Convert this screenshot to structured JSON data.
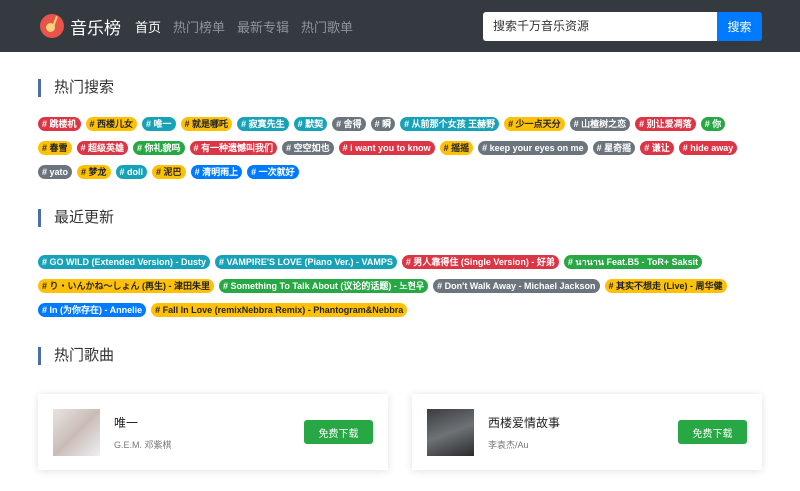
{
  "nav": {
    "brand": "音乐榜",
    "links": [
      "首页",
      "热门榜单",
      "最新专辑",
      "热门歌单"
    ],
    "search_placeholder": "搜索千万音乐资源",
    "search_button": "搜索"
  },
  "hot_search": {
    "title": "热门搜索",
    "tags": [
      {
        "text": "# 跳楼机",
        "color": "r"
      },
      {
        "text": "# 西楼儿女",
        "color": "y"
      },
      {
        "text": "# 唯一",
        "color": "t"
      },
      {
        "text": "# 就是哪吒",
        "color": "y"
      },
      {
        "text": "# 寂寞先生",
        "color": "t"
      },
      {
        "text": "# 默契",
        "color": "t"
      },
      {
        "text": "# 舍得",
        "color": "g"
      },
      {
        "text": "# 瞬",
        "color": "g"
      },
      {
        "text": "# 从前那个女孩 王赫野",
        "color": "t"
      },
      {
        "text": "# 少一点天分",
        "color": "y"
      },
      {
        "text": "# 山楂树之恋",
        "color": "g"
      },
      {
        "text": "# 别让爱凋落",
        "color": "r"
      },
      {
        "text": "# 你",
        "color": "gr"
      },
      {
        "text": "# 春雪",
        "color": "y"
      },
      {
        "text": "# 超级英雄",
        "color": "r"
      },
      {
        "text": "# 你礼貌吗",
        "color": "gr"
      },
      {
        "text": "# 有一种遗憾叫我们",
        "color": "r"
      },
      {
        "text": "# 空空如也",
        "color": "g"
      },
      {
        "text": "# i want you to know",
        "color": "r"
      },
      {
        "text": "# 摇摇",
        "color": "y"
      },
      {
        "text": "# keep your eyes on me",
        "color": "g"
      },
      {
        "text": "# 星奇摇",
        "color": "g"
      },
      {
        "text": "# 谦让",
        "color": "r"
      },
      {
        "text": "# hide away",
        "color": "r"
      },
      {
        "text": "# yato",
        "color": "g"
      },
      {
        "text": "# 梦龙",
        "color": "y"
      },
      {
        "text": "# doll",
        "color": "t"
      },
      {
        "text": "# 泥巴",
        "color": "y"
      },
      {
        "text": "# 清明雨上",
        "color": "b"
      },
      {
        "text": "# 一次就好",
        "color": "b"
      }
    ]
  },
  "recent": {
    "title": "最近更新",
    "tags": [
      {
        "text": "# GO WILD (Extended Version) - Dusty",
        "color": "t"
      },
      {
        "text": "# VAMPIRE'S LOVE (Piano Ver.) - VAMPS",
        "color": "t"
      },
      {
        "text": "# 男人靠得住 (Single Version) - 好弟",
        "color": "r"
      },
      {
        "text": "# นานาน Feat.B5 - ToR+ Saksit",
        "color": "gr"
      },
      {
        "text": "# り・いんかね～しょん (再生) - 津田朱里",
        "color": "y"
      },
      {
        "text": "# Something To Talk About (议论的话题) - 노현우",
        "color": "gr"
      },
      {
        "text": "# Don't Walk Away - Michael Jackson",
        "color": "g"
      },
      {
        "text": "# 其实不想走 (Live) - 周华健",
        "color": "y"
      },
      {
        "text": "# In (为你存在) - Annelie",
        "color": "b"
      },
      {
        "text": "# Fall In Love (remixNebbra Remix) - Phantogram&Nebbra",
        "color": "y"
      }
    ]
  },
  "hot_songs": {
    "title": "热门歌曲",
    "items": [
      {
        "title": "唯一",
        "artist": "G.E.M. 邓紫棋",
        "button": "免费下载"
      },
      {
        "title": "西楼爱情故事",
        "artist": "李袁杰/Au",
        "button": "免费下载"
      }
    ]
  }
}
